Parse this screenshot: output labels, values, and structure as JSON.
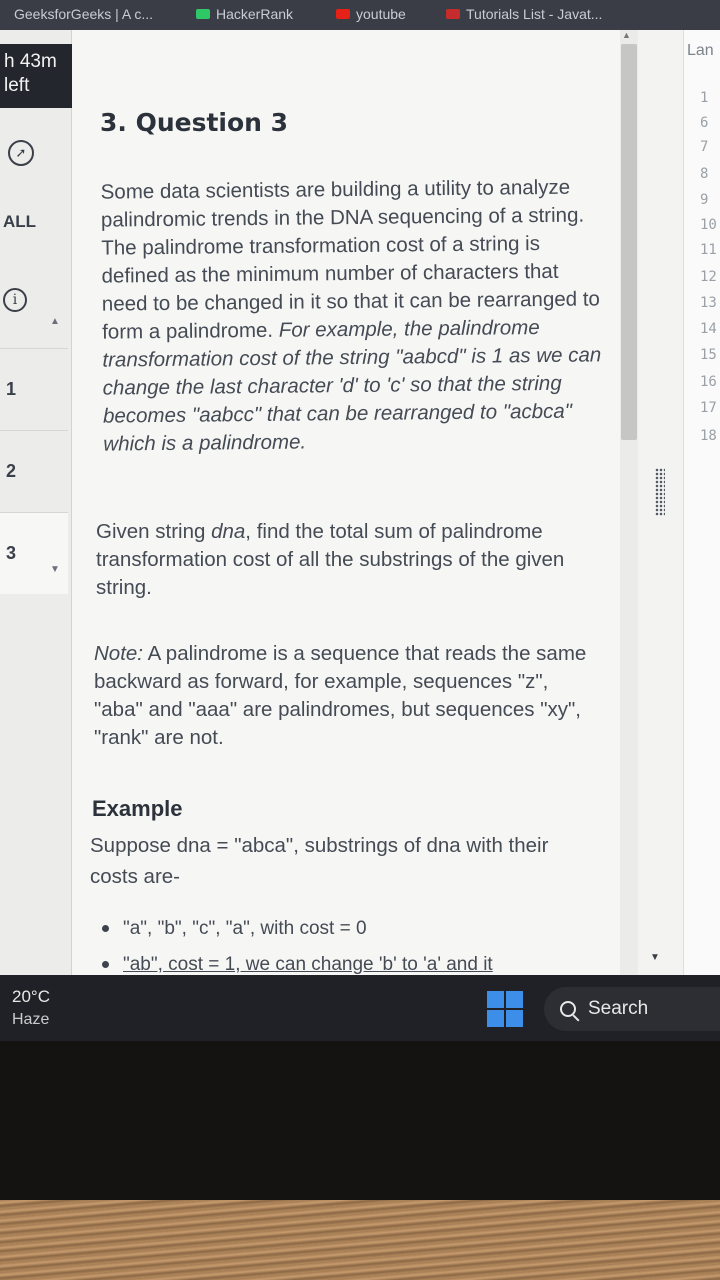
{
  "bookmarks": [
    {
      "label": "GeeksforGeeks | A c...",
      "icon": "gfg-icon",
      "color": "#2f8d46"
    },
    {
      "label": "HackerRank",
      "icon": "hackerrank-icon",
      "color": "#2ec866"
    },
    {
      "label": "youtube",
      "icon": "youtube-icon",
      "color": "#e62117"
    },
    {
      "label": "Tutorials List - Javat...",
      "icon": "bookmark-icon",
      "color": "#c72c2c"
    }
  ],
  "rail": {
    "timer_value": "h 43m",
    "timer_unit": "left",
    "filter_label": "ALL",
    "questions": [
      "1",
      "2",
      "3"
    ]
  },
  "problem": {
    "title": "3. Question 3",
    "p1_a": "Some data scientists are building a utility to analyze palindromic trends in the DNA sequencing of a string. The palindrome transformation cost of a string is defined as the minimum number of characters that need to be changed in it so that it can be rearranged to form a palindrome.",
    "p1_b": "For example, the palindrome transformation cost of the string \"aabcd\" is 1 as we can change the last character 'd' to 'c' so that the string becomes \"aabcc\" that can be rearranged to \"acbca\" which is a palindrome.",
    "p2_a": "Given string ",
    "p2_var": "dna",
    "p2_b": ", find the total sum of palindrome transformation cost of all the substrings of the given string.",
    "note_label": "Note:",
    "note_text": " A palindrome is a sequence that reads the same backward as forward, for example, sequences \"z\", \"aba\" and \"aaa\" are palindromes, but sequences \"xy\", \"rank\" are not.",
    "example_title": "Example",
    "example_text": "Suppose dna = \"abca\", substrings of dna with their costs are-",
    "bullets": [
      "\"a\", \"b\", \"c\", \"a\", with cost = 0",
      "\"ab\", cost = 1, we can change 'b' to 'a' and it"
    ]
  },
  "editor": {
    "language_label": "Lan",
    "line_numbers": [
      "1",
      "6",
      "7",
      "8",
      "9",
      "10",
      "11",
      "12",
      "13",
      "14",
      "15",
      "16",
      "17",
      "18"
    ]
  },
  "taskbar": {
    "temperature": "20°C",
    "condition": "Haze",
    "search_label": "Search",
    "accent": "#3d8ee8"
  }
}
